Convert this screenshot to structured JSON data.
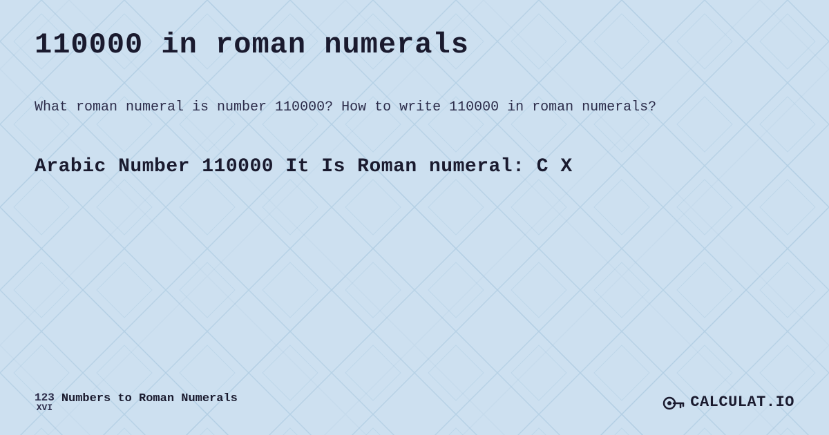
{
  "background": {
    "color": "#c8dff0",
    "pattern_color": "#b8d0e8"
  },
  "header": {
    "title": "110000 in roman numerals"
  },
  "description": {
    "text": "What roman numeral is number 110000? How to write 110000 in roman numerals?"
  },
  "result": {
    "text": "Arabic Number 110000 It Is  Roman numeral: C X"
  },
  "footer": {
    "brand_arabic": "123",
    "brand_roman": "XVI",
    "brand_label": "Numbers to Roman Numerals",
    "logo_text": "CALCULAT.IO"
  }
}
